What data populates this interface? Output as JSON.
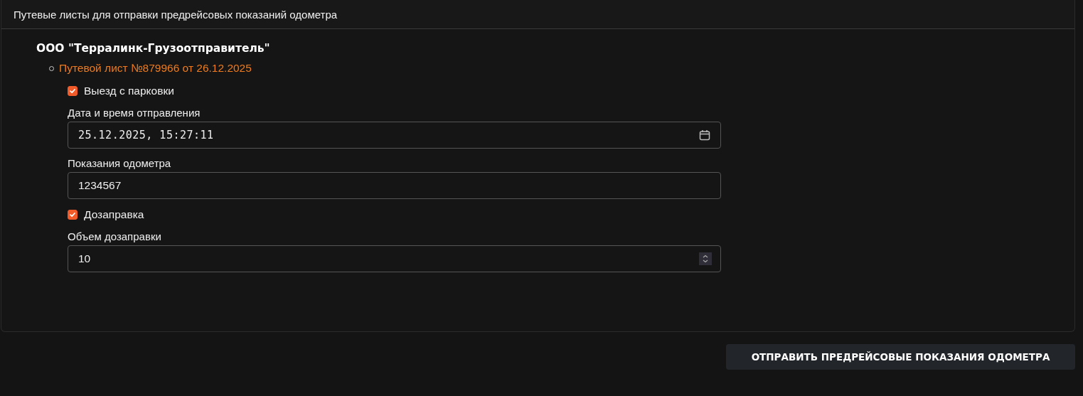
{
  "panel": {
    "title": "Путевые листы для отправки предрейсовых показаний одометра"
  },
  "company": {
    "name": "ООО \"Терралинк-Грузоотправитель\"",
    "waybills": [
      {
        "title": "Путевой лист №879966 от 26.12.2025",
        "fields": [
          {
            "kind": "checkbox",
            "label": "Выезд с парковки",
            "checked": true
          },
          {
            "kind": "datetime",
            "label": "Дата и время отправления",
            "value": "25.12.2025, 15:27:11"
          },
          {
            "kind": "text",
            "label": "Показания одометра",
            "value": "1234567"
          },
          {
            "kind": "checkbox",
            "label": "Дозаправка",
            "checked": true
          },
          {
            "kind": "number",
            "label": "Объем дозаправки",
            "value": "10"
          }
        ]
      }
    ]
  },
  "submit_button": "ОТПРАВИТЬ ПРЕДРЕЙСОВЫЕ ПОКАЗАНИЯ ОДОМЕТРА"
}
